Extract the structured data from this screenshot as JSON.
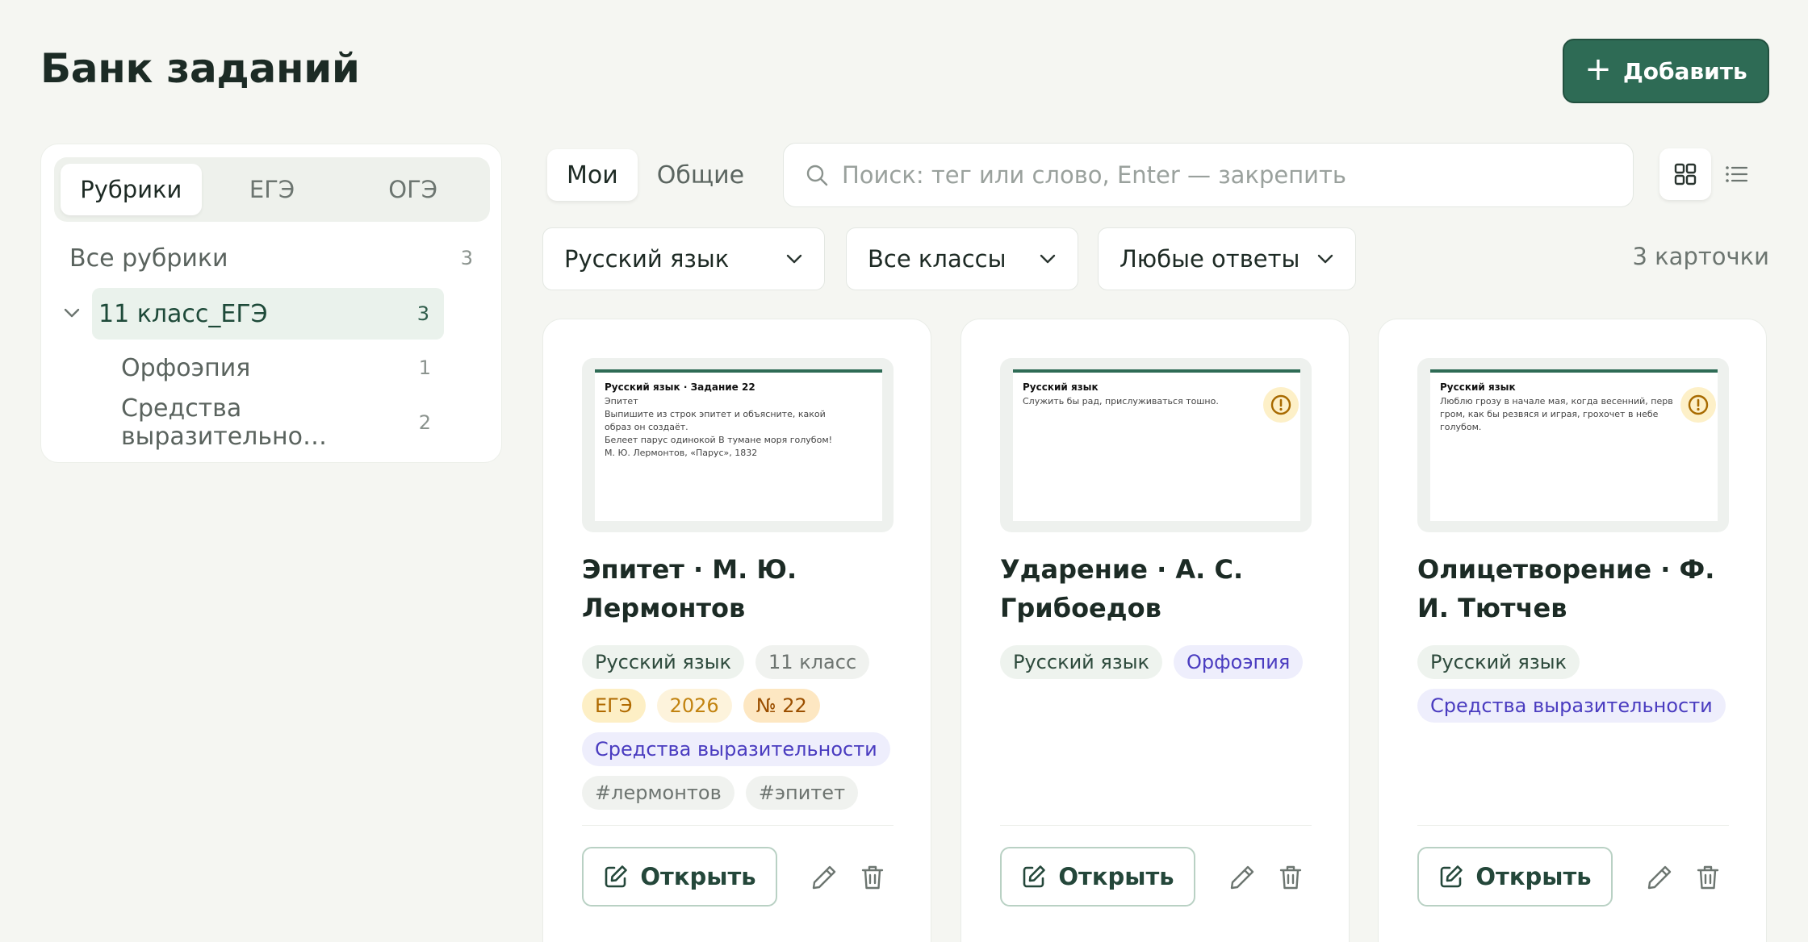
{
  "header": {
    "title": "Банк заданий",
    "add_label": "Добавить"
  },
  "sidebar": {
    "tabs": [
      {
        "label": "Рубрики",
        "active": true
      },
      {
        "label": "ЕГЭ",
        "active": false
      },
      {
        "label": "ОГЭ",
        "active": false
      }
    ],
    "tree": [
      {
        "label": "Все рубрики",
        "count": "3"
      },
      {
        "label": "11 класс_ЕГЭ",
        "count": "3"
      },
      {
        "label": "Орфоэпия",
        "count": "1"
      },
      {
        "label": "Средства выразительно…",
        "count": "2"
      }
    ]
  },
  "toolbar": {
    "scope": [
      {
        "label": "Мои",
        "active": true
      },
      {
        "label": "Общие",
        "active": false
      }
    ],
    "search_placeholder": "Поиск: тег или слово, Enter — закрепить",
    "view_mode": "grid"
  },
  "filters": {
    "subject": "Русский язык",
    "grade": "Все классы",
    "answers": "Любые ответы",
    "count_label": "3 карточки"
  },
  "cards": [
    {
      "preview_title": "Русский язык · Задание 22",
      "preview_text": "Эпитет\nВыпишите из строк эпитет и объясните, какой\nобраз он создаёт.\nБелеет парус одинокой В тумане моря голубом!\nМ. Ю. Лермонтов, «Парус», 1832",
      "title": "Эпитет · М. Ю. Лермонтов",
      "tags": {
        "subject": "Русский язык",
        "grade": "11 класс",
        "exam": "ЕГЭ",
        "year": "2026",
        "number": "№ 22",
        "rubric": "Средства выразительности",
        "hash1": "#лермонтов",
        "hash2": "#эпитет"
      },
      "open_label": "Открыть"
    },
    {
      "preview_title": "Русский язык",
      "preview_text": "Служить бы рад, прислуживаться тошно.",
      "title": "Ударение · А. С. Грибоедов",
      "tags": {
        "subject": "Русский язык",
        "rubric": "Орфоэпия"
      },
      "open_label": "Открыть"
    },
    {
      "preview_title": "Русский язык",
      "preview_text": "Люблю грозу в начале мая, когда весенний, перв\nгром, как бы резвяся и играя, грохочет в небе\nголубом.",
      "title": "Олицетворение · Ф. И. Тютчев",
      "tags": {
        "subject": "Русский язык",
        "rubric": "Средства выразительности"
      },
      "open_label": "Открыть"
    }
  ],
  "colors": {
    "accent": "#2e6b55",
    "background": "#f5f6f2",
    "warning": "#fdf0c8"
  }
}
